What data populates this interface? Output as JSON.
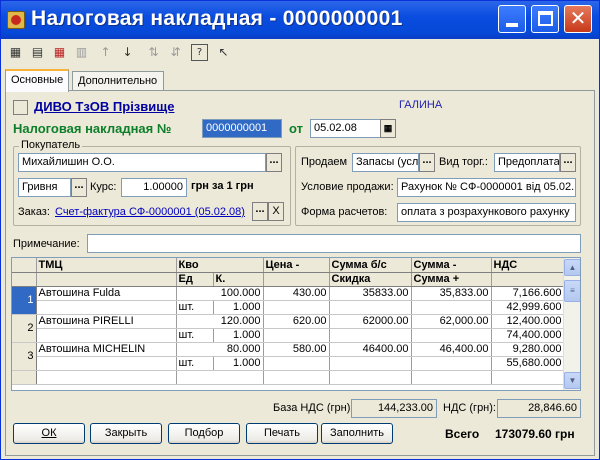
{
  "window": {
    "title": "Налоговая накладная - 0000000001"
  },
  "tabs": [
    {
      "label": "Основные"
    },
    {
      "label": "Дополнительно"
    }
  ],
  "header": {
    "org": "ДИВО ТзОВ Прізвище",
    "user": "ГАЛИНА",
    "doc_label": "Налоговая накладная №",
    "doc_number": "0000000001",
    "date_label": "от",
    "date": "05.02.08"
  },
  "buyer": {
    "group_title": "Покупатель",
    "name": "Михайлишин О.О.",
    "currency": "Гривня",
    "rate_label": "Курс:",
    "rate": "1.00000",
    "rate_suffix": "грн за 1 грн",
    "order_label": "Заказ:",
    "order_link": "Счет-фактура СФ-0000001 (05.02.08)",
    "x_label": "X"
  },
  "sale": {
    "sell_label": "Продаем",
    "sell_value": "Запасы (усл",
    "trade_label": "Вид торг.:",
    "trade_value": "Предоплата",
    "condition_label": "Условие продажи:",
    "condition_value": "Рахунок № СФ-0000001 від 05.02.",
    "payment_label": "Форма расчетов:",
    "payment_value": "оплата з розрахункового рахунку"
  },
  "note": {
    "label": "Примечание:",
    "value": ""
  },
  "grid": {
    "headers_top": [
      "ТМЦ",
      "Кво",
      "",
      "Цена -",
      "Сумма б/с",
      "Сумма -",
      "НДС"
    ],
    "headers_bottom": [
      "",
      "Ед",
      "К.",
      "",
      "Скидка",
      "Сумма +",
      ""
    ],
    "rows": [
      {
        "n": "1",
        "name": "Автошина Fulda",
        "qty": "100.000",
        "unit": "шт.",
        "k": "1.000",
        "price": "430.00",
        "sum_bs": "35833.00",
        "sum_minus": "35,833.00",
        "vat": "7,166.600",
        "sum_plus": "42,999.600"
      },
      {
        "n": "2",
        "name": "Автошина PIRELLI",
        "qty": "120.000",
        "unit": "шт.",
        "k": "1.000",
        "price": "620.00",
        "sum_bs": "62000.00",
        "sum_minus": "62,000.00",
        "vat": "12,400.000",
        "sum_plus": "74,400.000"
      },
      {
        "n": "3",
        "name": "Автошина MICHELIN",
        "qty": "80.000",
        "unit": "шт.",
        "k": "1.000",
        "price": "580.00",
        "sum_bs": "46400.00",
        "sum_minus": "46,400.00",
        "vat": "9,280.000",
        "sum_plus": "55,680.000"
      }
    ]
  },
  "totals": {
    "base_label": "База НДС (грн):",
    "base_value": "144,233.00",
    "vat_label": "НДС (грн):",
    "vat_value": "28,846.60",
    "total_label": "Всего",
    "total_value": "173079.60 грн"
  },
  "buttons": {
    "ok": "ОК",
    "close": "Закрыть",
    "select": "Подбор",
    "print": "Печать",
    "fill": "Заполнить"
  },
  "colors": {
    "title_bar": "#0a4de0",
    "accent_green": "#0d7f2a",
    "link_blue": "#0000c0",
    "selection": "#316ac5"
  }
}
